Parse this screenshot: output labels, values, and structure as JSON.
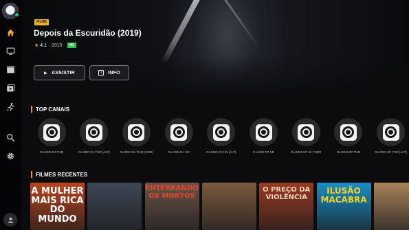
{
  "hero": {
    "genre": "FILME",
    "title": "Depois da Escuridão (2019)",
    "rating": "4.1",
    "year": "2019",
    "quality": "HD",
    "watch_label": "ASSISTIR",
    "info_label": "INFO"
  },
  "sections": {
    "channels_title": "TOP CANAIS",
    "movies_title": "FILMES RECENTES"
  },
  "channels": [
    {
      "name": "GLOBO RJ FHD"
    },
    {
      "name": "GLOBO RJ FHD [ALT]"
    },
    {
      "name": "GLOBO RJ FHD [H265]"
    },
    {
      "name": "GLOBO RJ HD"
    },
    {
      "name": "GLOBO RJ HD [ALT]"
    },
    {
      "name": "GLOBO RJ SD"
    },
    {
      "name": "GLOBO SP 4K FHDR"
    },
    {
      "name": "GLOBO SP FHD"
    },
    {
      "name": "GLOBO SP FHD [ALT]"
    }
  ],
  "movies": [
    {
      "text": "A MULHER MAIS RICA DO MUNDO",
      "bg": "#b8451f",
      "fg": "#ffffff"
    },
    {
      "text": "",
      "bg": "#3e4754",
      "fg": "#ffffff"
    },
    {
      "text": "ENTERRANDO OS MORTOS",
      "bg": "#6a5445",
      "fg": "#e8432e"
    },
    {
      "text": "",
      "bg": "#7c5a3e",
      "fg": "#ffffff"
    },
    {
      "text": "O PREÇO DA VIOLÊNCIA",
      "bg": "#9a3a22",
      "fg": "#f4d5b8"
    },
    {
      "text": "ILUSÃO MACABRA",
      "bg": "#1a8fc7",
      "fg": "#f7d21b"
    },
    {
      "text": "",
      "bg": "#a9835a",
      "fg": "#ffffff"
    }
  ],
  "colors": {
    "accent": "#e8961c",
    "genre_badge": "#e9b22c",
    "hd_badge": "#3dbb4a",
    "sidebar_active": "#e9a23b"
  },
  "icons": [
    "home-icon",
    "tv-icon",
    "movie-icon",
    "series-icon",
    "sports-icon",
    "search-icon",
    "settings-icon",
    "profile-icon"
  ]
}
